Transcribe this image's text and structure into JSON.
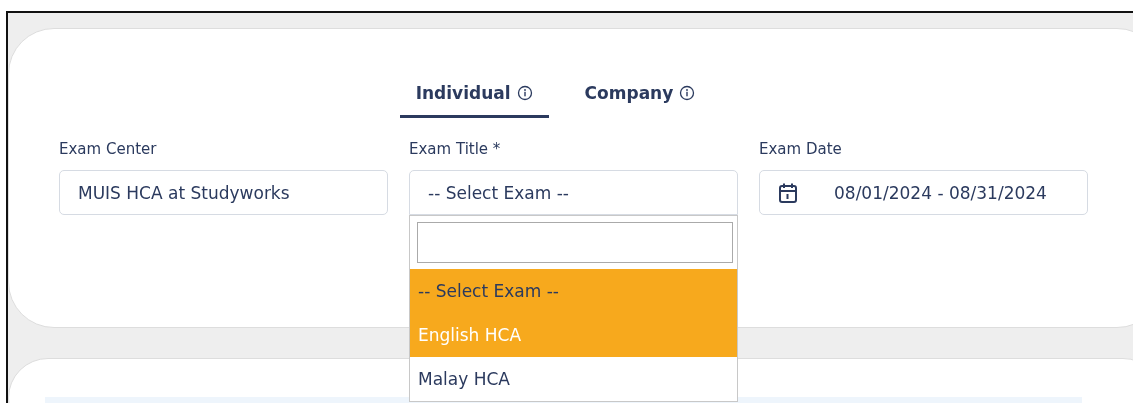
{
  "tabs": [
    {
      "label": "Individual",
      "selected": true
    },
    {
      "label": "Company",
      "selected": false
    }
  ],
  "fields": [
    {
      "kind": "text",
      "label": "Exam Center",
      "value": "MUIS HCA at Studyworks"
    },
    {
      "kind": "select",
      "label": "Exam Title *",
      "value": "-- Select Exam --",
      "expanded": true
    },
    {
      "kind": "date",
      "label": "Exam Date",
      "value": "08/01/2024 - 08/31/2024"
    }
  ],
  "dropdown": {
    "options": [
      {
        "label": "-- Select Exam --",
        "selected": true,
        "hovered": false
      },
      {
        "label": "English HCA",
        "selected": false,
        "hovered": true
      },
      {
        "label": "Malay HCA",
        "selected": false,
        "hovered": false
      }
    ]
  }
}
